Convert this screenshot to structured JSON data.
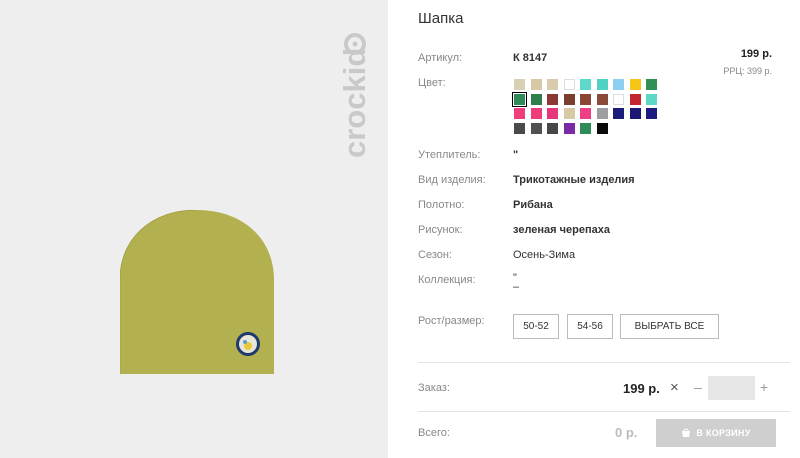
{
  "brand": {
    "logo_text": "crockid"
  },
  "product": {
    "title": "Шапка",
    "price": "199 р.",
    "rrp": "РРЦ: 399 р."
  },
  "fields": {
    "article": {
      "label": "Артикул:",
      "value": "К 8147"
    },
    "color": {
      "label": "Цвет:"
    },
    "insulation": {
      "label": "Утеплитель:",
      "value": "\""
    },
    "product_type": {
      "label": "Вид изделия:",
      "value": "Трикотажные изделия"
    },
    "fabric": {
      "label": "Полотно:",
      "value": "Рибана"
    },
    "pattern": {
      "label": "Рисунок:",
      "value": "зеленая черепаха"
    },
    "season": {
      "label": "Сезон:",
      "value": "Осень-Зима"
    },
    "collection": {
      "label": "Коллекция:",
      "value": "\"",
      "value2": "–"
    },
    "size": {
      "label": "Рост/размер:"
    }
  },
  "swatches": [
    [
      "#d9cfb2",
      "#d6c9a5",
      "#d8ccad",
      "#ffffff",
      "#5ed8c9",
      "#4fd2c4",
      "#8ccff0",
      "#f5c518",
      "#2f8f57"
    ],
    [
      "#2e8a56",
      "#2d7f4c",
      "#8b3a33",
      "#7a3d2e",
      "#8a4533",
      "#8b4a3a",
      "#ffffff",
      "#c3262e",
      "#5dd8c6"
    ],
    [
      "#f03e7c",
      "#ef3c7a",
      "#e8367a",
      "#d7c9a6",
      "#ee3f84",
      "#9e9ea2",
      "#1b1b7a",
      "#1a1775",
      "#1c1a80"
    ],
    [
      "#4a4a4a",
      "#515151",
      "#474747",
      "#7a2aa6",
      "#2f8b57",
      "#0a0a0a"
    ]
  ],
  "sizes": [
    "50-52",
    "54-56"
  ],
  "select_all_label": "ВЫБРАТЬ ВСЕ",
  "order": {
    "label": "Заказ:",
    "price": "199 р.",
    "times": "×",
    "minus": "–",
    "plus": "+",
    "quantity": ""
  },
  "total": {
    "label": "Всего:",
    "value": "0 р.",
    "cart_button": "В КОРЗИНУ"
  },
  "colors": {
    "hat": "#b3b04f",
    "image_bg": "#efeeef",
    "button_disabled": "#cfcfcf"
  }
}
